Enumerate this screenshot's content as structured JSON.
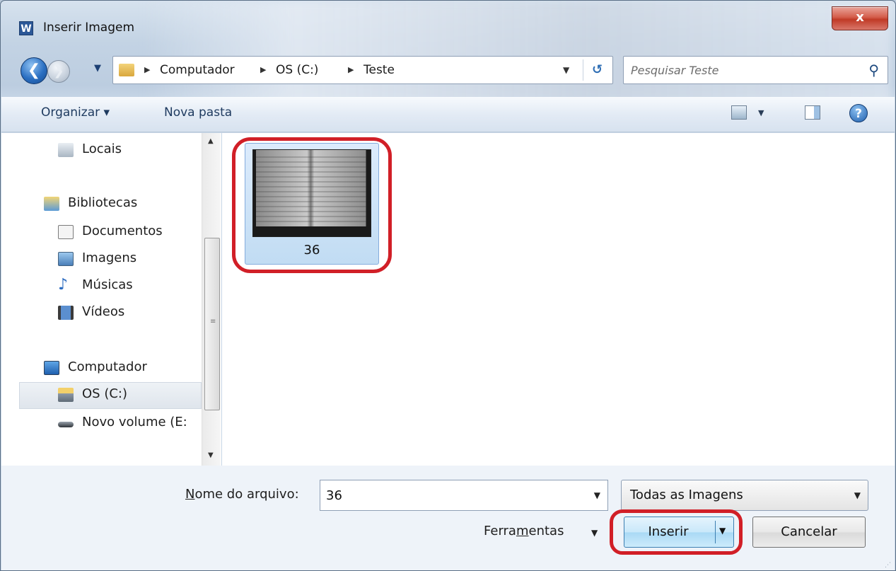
{
  "window": {
    "title": "Inserir Imagem",
    "app_icon_letter": "W",
    "close_label": "x"
  },
  "nav": {
    "back_glyph": "❮",
    "forward_glyph": "❯",
    "breadcrumb": [
      "Computador",
      "OS (C:)",
      "Teste"
    ],
    "search_placeholder": "Pesquisar Teste"
  },
  "toolbar": {
    "organize_label": "Organizar ▾",
    "new_folder_label": "Nova pasta",
    "help_glyph": "?"
  },
  "sidebar": {
    "items": [
      {
        "label": "Locais",
        "icon": "places-icon"
      },
      {
        "label": "Bibliotecas",
        "icon": "libraries-icon"
      },
      {
        "label": "Documentos",
        "icon": "documents-icon"
      },
      {
        "label": "Imagens",
        "icon": "pictures-icon"
      },
      {
        "label": "Músicas",
        "icon": "music-icon"
      },
      {
        "label": "Vídeos",
        "icon": "videos-icon"
      },
      {
        "label": "Computador",
        "icon": "computer-icon"
      },
      {
        "label": "OS (C:)",
        "icon": "drive-c-icon"
      },
      {
        "label": "Novo volume (E:",
        "icon": "drive-e-icon"
      }
    ],
    "selected": "OS (C:)"
  },
  "files": [
    {
      "name": "36",
      "selected": true
    }
  ],
  "bottom": {
    "filename_label_prefix": "N",
    "filename_label_rest": "ome do arquivo:",
    "filename_value": "36",
    "filetype_value": "Todas as Imagens",
    "tools_prefix": "Ferra",
    "tools_underlined": "m",
    "tools_rest": "entas",
    "insert_label": "Inserir",
    "cancel_label": "Cancelar"
  },
  "colors": {
    "highlight_annotation": "#d11f27",
    "selection": "#cce4f7"
  }
}
